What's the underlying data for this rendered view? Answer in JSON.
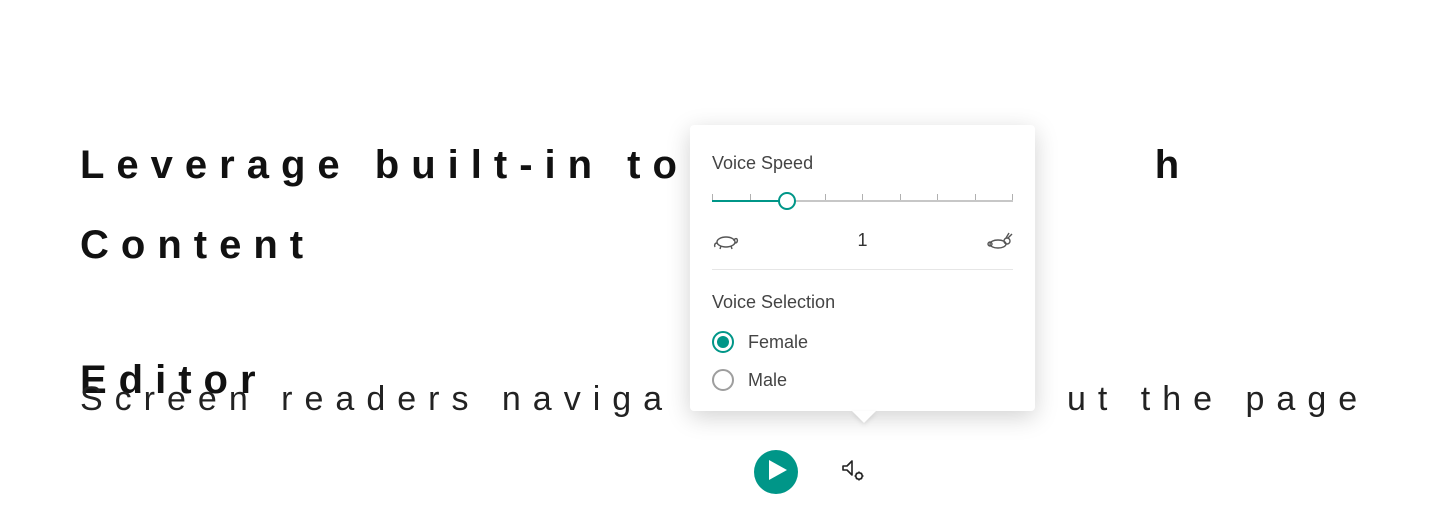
{
  "heading_line1": "Leverage built-in tool",
  "heading_suffix": "h Content",
  "heading_line2": "Editor",
  "body_prefix": "Screen readers naviga",
  "body_suffix": "ut the page",
  "popover": {
    "speed_title": "Voice Speed",
    "speed_value": "1",
    "slider": {
      "min": 0,
      "max": 8,
      "value": 2,
      "ticks": 9
    },
    "selection_title": "Voice Selection",
    "options": [
      {
        "label": "Female",
        "selected": true
      },
      {
        "label": "Male",
        "selected": false
      }
    ]
  },
  "icons": {
    "slow": "turtle-icon",
    "fast": "rabbit-icon",
    "play": "play-icon",
    "settings": "audio-settings-icon"
  },
  "colors": {
    "accent": "#009688"
  }
}
